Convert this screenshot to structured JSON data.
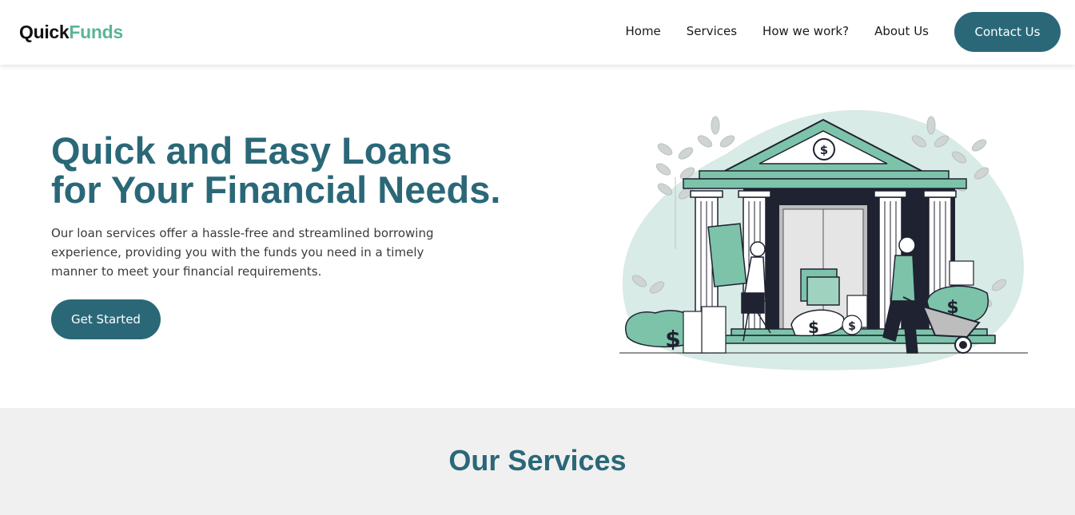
{
  "brand": {
    "part1": "Quick",
    "part2": "Funds"
  },
  "nav": {
    "items": [
      {
        "label": "Home"
      },
      {
        "label": "Services"
      },
      {
        "label": "How we work?"
      },
      {
        "label": "About Us"
      }
    ],
    "contact_label": "Contact Us"
  },
  "hero": {
    "title_line1": "Quick and Easy Loans",
    "title_line2": "for Your Financial Needs.",
    "description": "Our loan services offer a hassle-free and streamlined borrowing experience, providing you with the funds you need in a timely manner to meet your financial requirements.",
    "cta_label": "Get Started"
  },
  "services": {
    "title": "Our Services"
  },
  "colors": {
    "primary": "#2a6878",
    "accent": "#5cb49a",
    "blob": "#d8ebe6",
    "green": "#7cc3aa",
    "dark": "#1f2230"
  },
  "icons": [
    "bank-illustration",
    "dollar-bag-icon",
    "coin-stack-icon",
    "wheelbarrow-icon",
    "leaf-icon"
  ]
}
